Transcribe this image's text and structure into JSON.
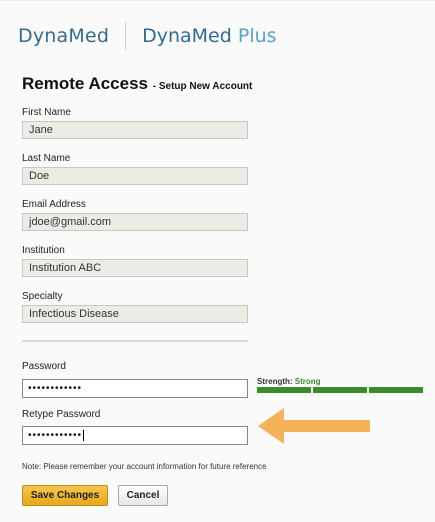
{
  "logos": {
    "primary": "DynaMed",
    "secondary_main": "DynaMed",
    "secondary_plus": "Plus"
  },
  "page": {
    "title": "Remote Access",
    "subtitle": "- Setup New Account"
  },
  "form": {
    "first_name": {
      "label": "First Name",
      "value": "Jane"
    },
    "last_name": {
      "label": "Last Name",
      "value": "Doe"
    },
    "email": {
      "label": "Email Address",
      "value": "jdoe@gmail.com"
    },
    "institution": {
      "label": "Institution",
      "value": "Institution ABC"
    },
    "specialty": {
      "label": "Specialty",
      "value": "Infectious Disease"
    },
    "password": {
      "label": "Password",
      "value": "••••••••••••"
    },
    "retype_password": {
      "label": "Retype Password",
      "value": "••••••••••••"
    }
  },
  "strength": {
    "label": "Strength:",
    "value": "Strong",
    "segments_filled": 3,
    "segments_total": 3,
    "color": "#3c8a2e"
  },
  "annotation": {
    "arrow_color": "#f5b25a",
    "icon": "left-arrow-icon"
  },
  "note": "Note: Please remember your account information for future reference",
  "buttons": {
    "save": "Save Changes",
    "cancel": "Cancel"
  }
}
